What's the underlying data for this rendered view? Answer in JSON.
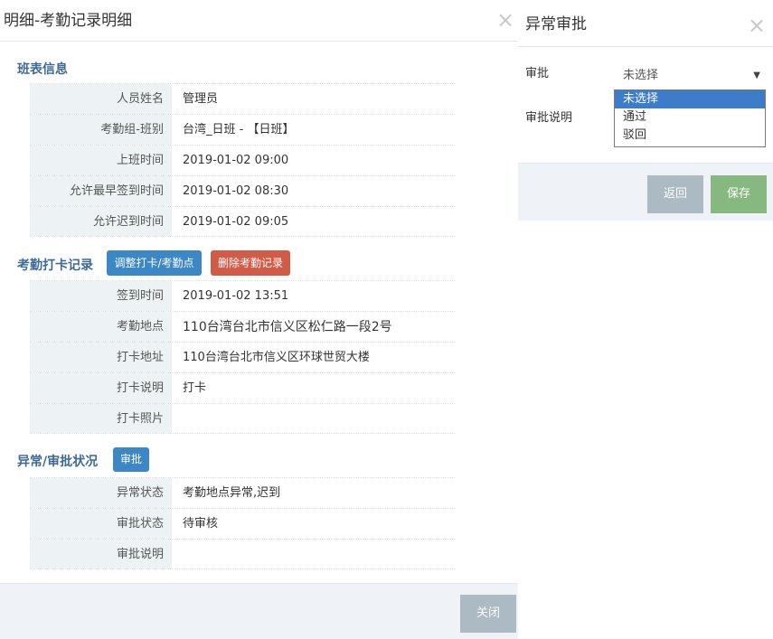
{
  "detail_modal": {
    "title": "明细-考勤记录明细",
    "close_icon": "×",
    "sections": {
      "schedule": {
        "title": "班表信息",
        "rows": [
          {
            "label": "人员姓名",
            "value": "管理员"
          },
          {
            "label": "考勤组-班别",
            "value": "台湾_日班 - 【日班】"
          },
          {
            "label": "上班时间",
            "value": "2019-01-02 09:00"
          },
          {
            "label": "允许最早签到时间",
            "value": "2019-01-02 08:30"
          },
          {
            "label": "允许迟到时间",
            "value": "2019-01-02 09:05"
          }
        ]
      },
      "punch": {
        "title": "考勤打卡记录",
        "adjust_button": "调整打卡/考勤点",
        "delete_button": "删除考勤记录",
        "rows": [
          {
            "label": "签到时间",
            "value": "2019-01-02 13:51"
          },
          {
            "label": "考勤地点",
            "value": "110台湾台北市信义区松仁路一段2号"
          },
          {
            "label": "打卡地址",
            "value": "110台湾台北市信义区环球世贸大楼"
          },
          {
            "label": "打卡说明",
            "value": "打卡"
          },
          {
            "label": "打卡照片",
            "value": ""
          }
        ]
      },
      "exception": {
        "title": "异常/审批状况",
        "approve_button": "审批",
        "rows": [
          {
            "label": "异常状态",
            "value": "考勤地点异常,迟到"
          },
          {
            "label": "审批状态",
            "value": "待审核"
          },
          {
            "label": "审批说明",
            "value": ""
          }
        ]
      }
    },
    "close_button": "关闭"
  },
  "approval_modal": {
    "title": "异常审批",
    "close_icon": "×",
    "approval_label": "审批",
    "approval_selected": "未选择",
    "arrow_icon": "▼",
    "approval_options": [
      "未选择",
      "通过",
      "驳回"
    ],
    "note_label": "审批说明",
    "back_button": "返回",
    "save_button": "保存"
  },
  "colors": {
    "section_title": "#3e6a94",
    "btn_blue": "#3c87c5",
    "btn_red": "#d15b47",
    "btn_gray": "#abbac3",
    "btn_green": "#87b87f",
    "label_bg": "#edf3f4",
    "footer_bg": "#eff3f8",
    "selected_option": "#3d7cc9"
  }
}
